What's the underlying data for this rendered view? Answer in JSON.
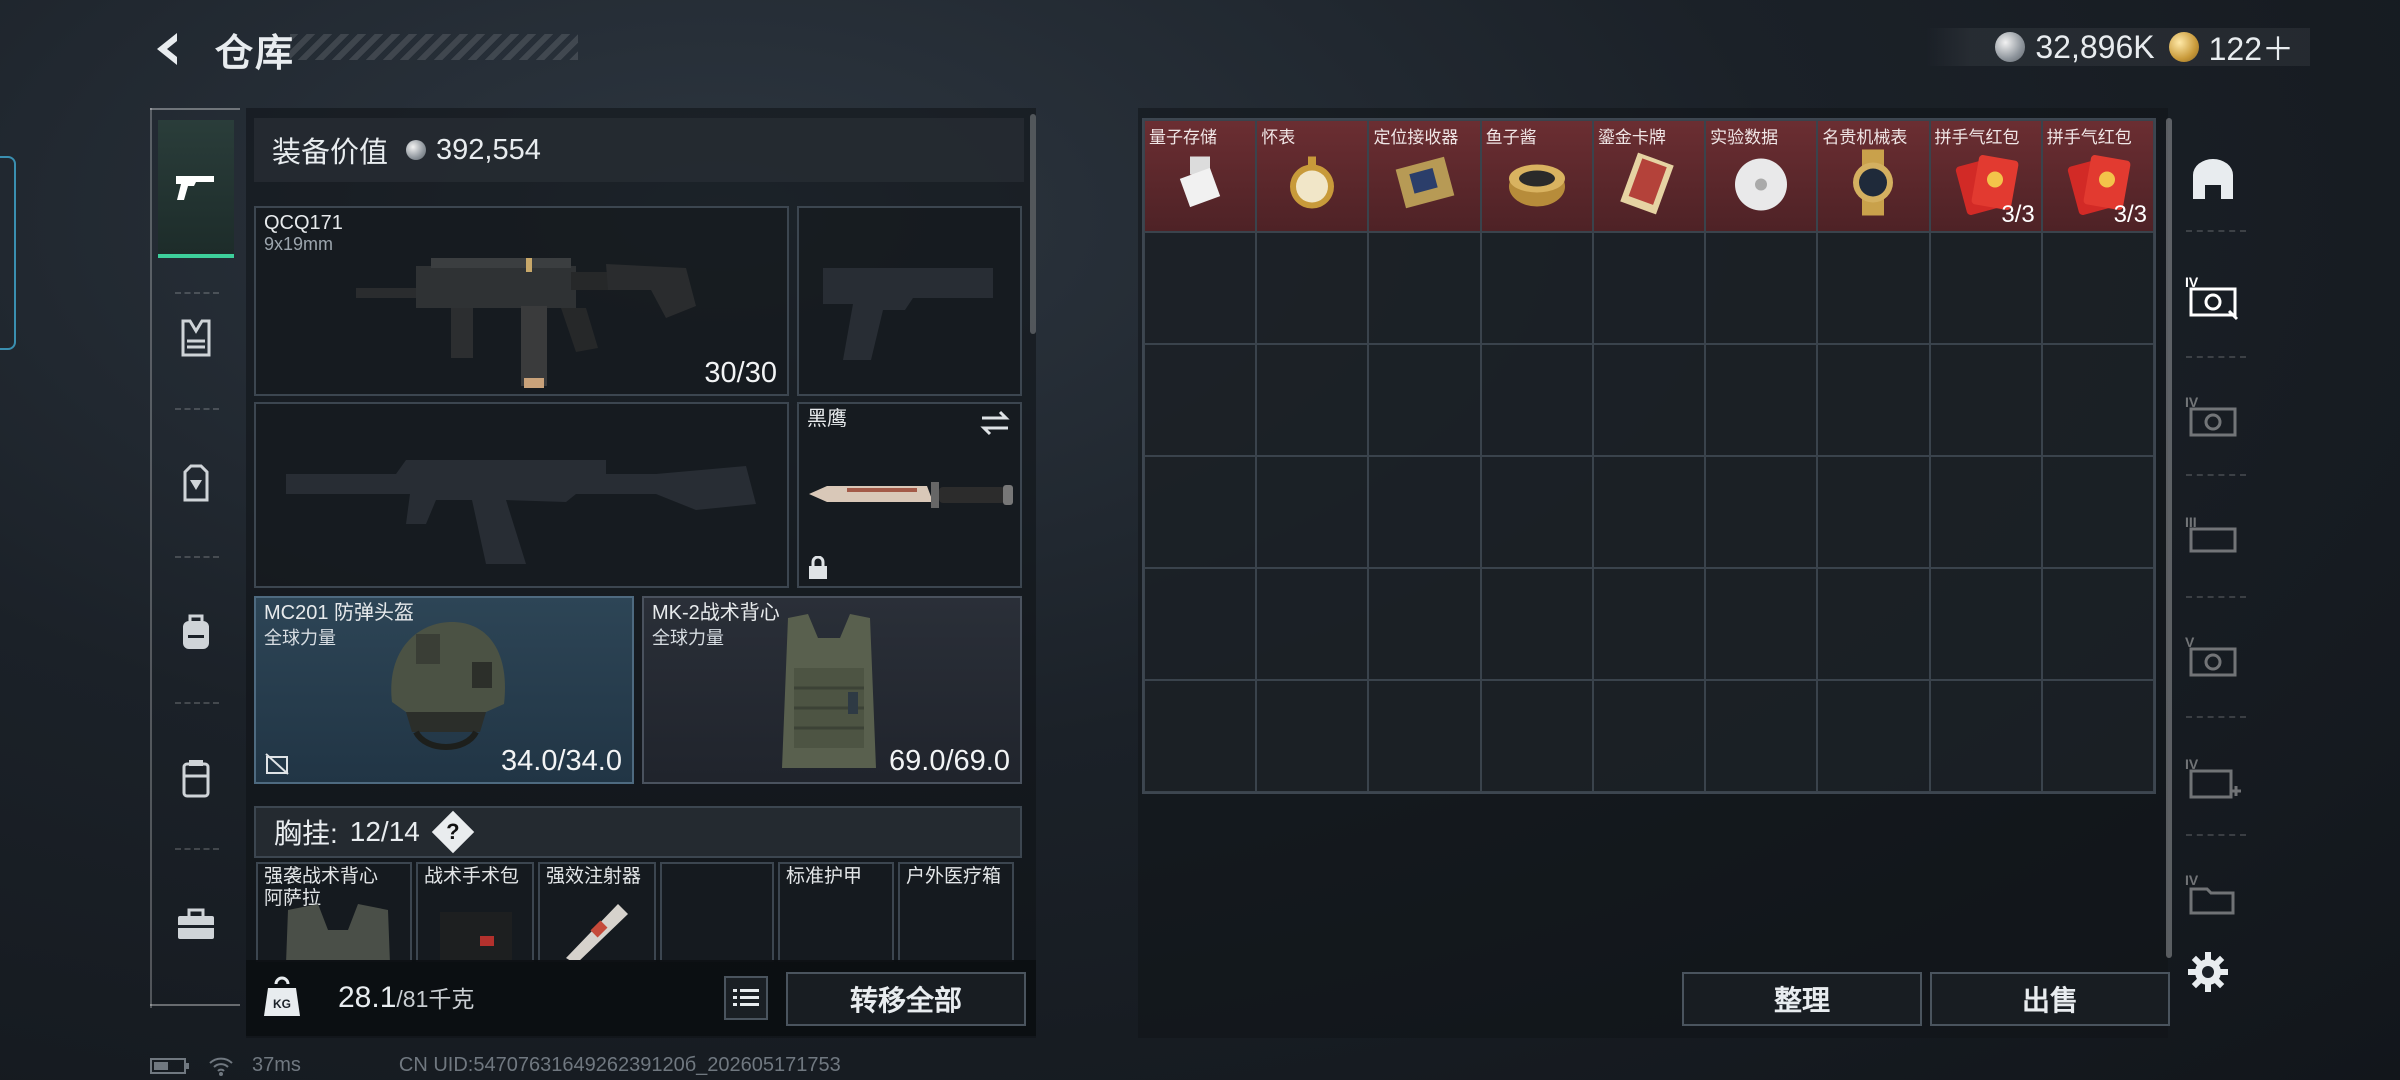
{
  "header": {
    "title": "仓库",
    "currency": [
      {
        "icon": "silver-coin-icon",
        "value": "32,896K"
      },
      {
        "icon": "gold-coin-icon",
        "value": "122＋"
      }
    ]
  },
  "left_rail": {
    "items": [
      {
        "name": "weapon-tab",
        "icon": "pistol-icon"
      },
      {
        "name": "armor-tab",
        "icon": "vest-icon"
      },
      {
        "name": "chest-rig-tab",
        "icon": "rig-icon"
      },
      {
        "name": "backpack-tab",
        "icon": "backpack-icon"
      },
      {
        "name": "pouch-tab",
        "icon": "pouch-icon"
      },
      {
        "name": "toolbox-tab",
        "icon": "toolbox-icon"
      }
    ]
  },
  "equipment": {
    "value_label": "装备价值",
    "value": "392,554",
    "primary_weapon": {
      "name": "QCQ171",
      "caliber": "9x19mm",
      "count": "30/30"
    },
    "knife": {
      "name": "黑鹰"
    },
    "helmet": {
      "name": "MC201 防弹头盔",
      "faction": "全球力量",
      "durability": "34.0/34.0"
    },
    "vest": {
      "name": "MK-2战术背心",
      "faction": "全球力量",
      "durability": "69.0/69.0"
    },
    "chest_label": "胸挂:",
    "chest_count": "12/14",
    "chest_help": "?",
    "chest_slots": [
      {
        "name": "强袭战术背心",
        "sub": "阿萨拉"
      },
      {
        "name": "战术手术包",
        "sub": ""
      },
      {
        "name": "强效注射器",
        "sub": ""
      },
      {
        "name": "",
        "sub": ""
      },
      {
        "name": "标准护甲",
        "sub": ""
      },
      {
        "name": "户外医疗箱",
        "sub": ""
      }
    ],
    "weight": "28.1",
    "weight_max": "/81千克",
    "transfer_label": "转移全部"
  },
  "stash": {
    "items": [
      {
        "name": "量子存储",
        "art": "usb"
      },
      {
        "name": "怀表",
        "art": "pocketwatch"
      },
      {
        "name": "定位接收器",
        "art": "receiver"
      },
      {
        "name": "鱼子酱",
        "art": "caviar"
      },
      {
        "name": "鎏金卡牌",
        "art": "cards"
      },
      {
        "name": "实验数据",
        "art": "disc"
      },
      {
        "name": "名贵机械表",
        "art": "watch"
      },
      {
        "name": "拼手气红包",
        "art": "redpacket",
        "count": "3/3"
      },
      {
        "name": "拼手气红包",
        "art": "redpacket",
        "count": "3/3"
      }
    ],
    "arrange_label": "整理",
    "sell_label": "出售"
  },
  "right_rail": {
    "items": [
      "safe-icon",
      "case-iv-icon",
      "case-iv-icon",
      "case-iii-icon",
      "case-v-icon",
      "case-iv-medical-icon",
      "case-iv-folder-icon"
    ]
  },
  "status": {
    "ping": "37ms",
    "uid": "CN UID:5470763164926239120б_202605171753"
  },
  "colors": {
    "accent": "#3dcf9b",
    "item_bg": "#5d282c",
    "panel_blue": "#2d4556"
  }
}
